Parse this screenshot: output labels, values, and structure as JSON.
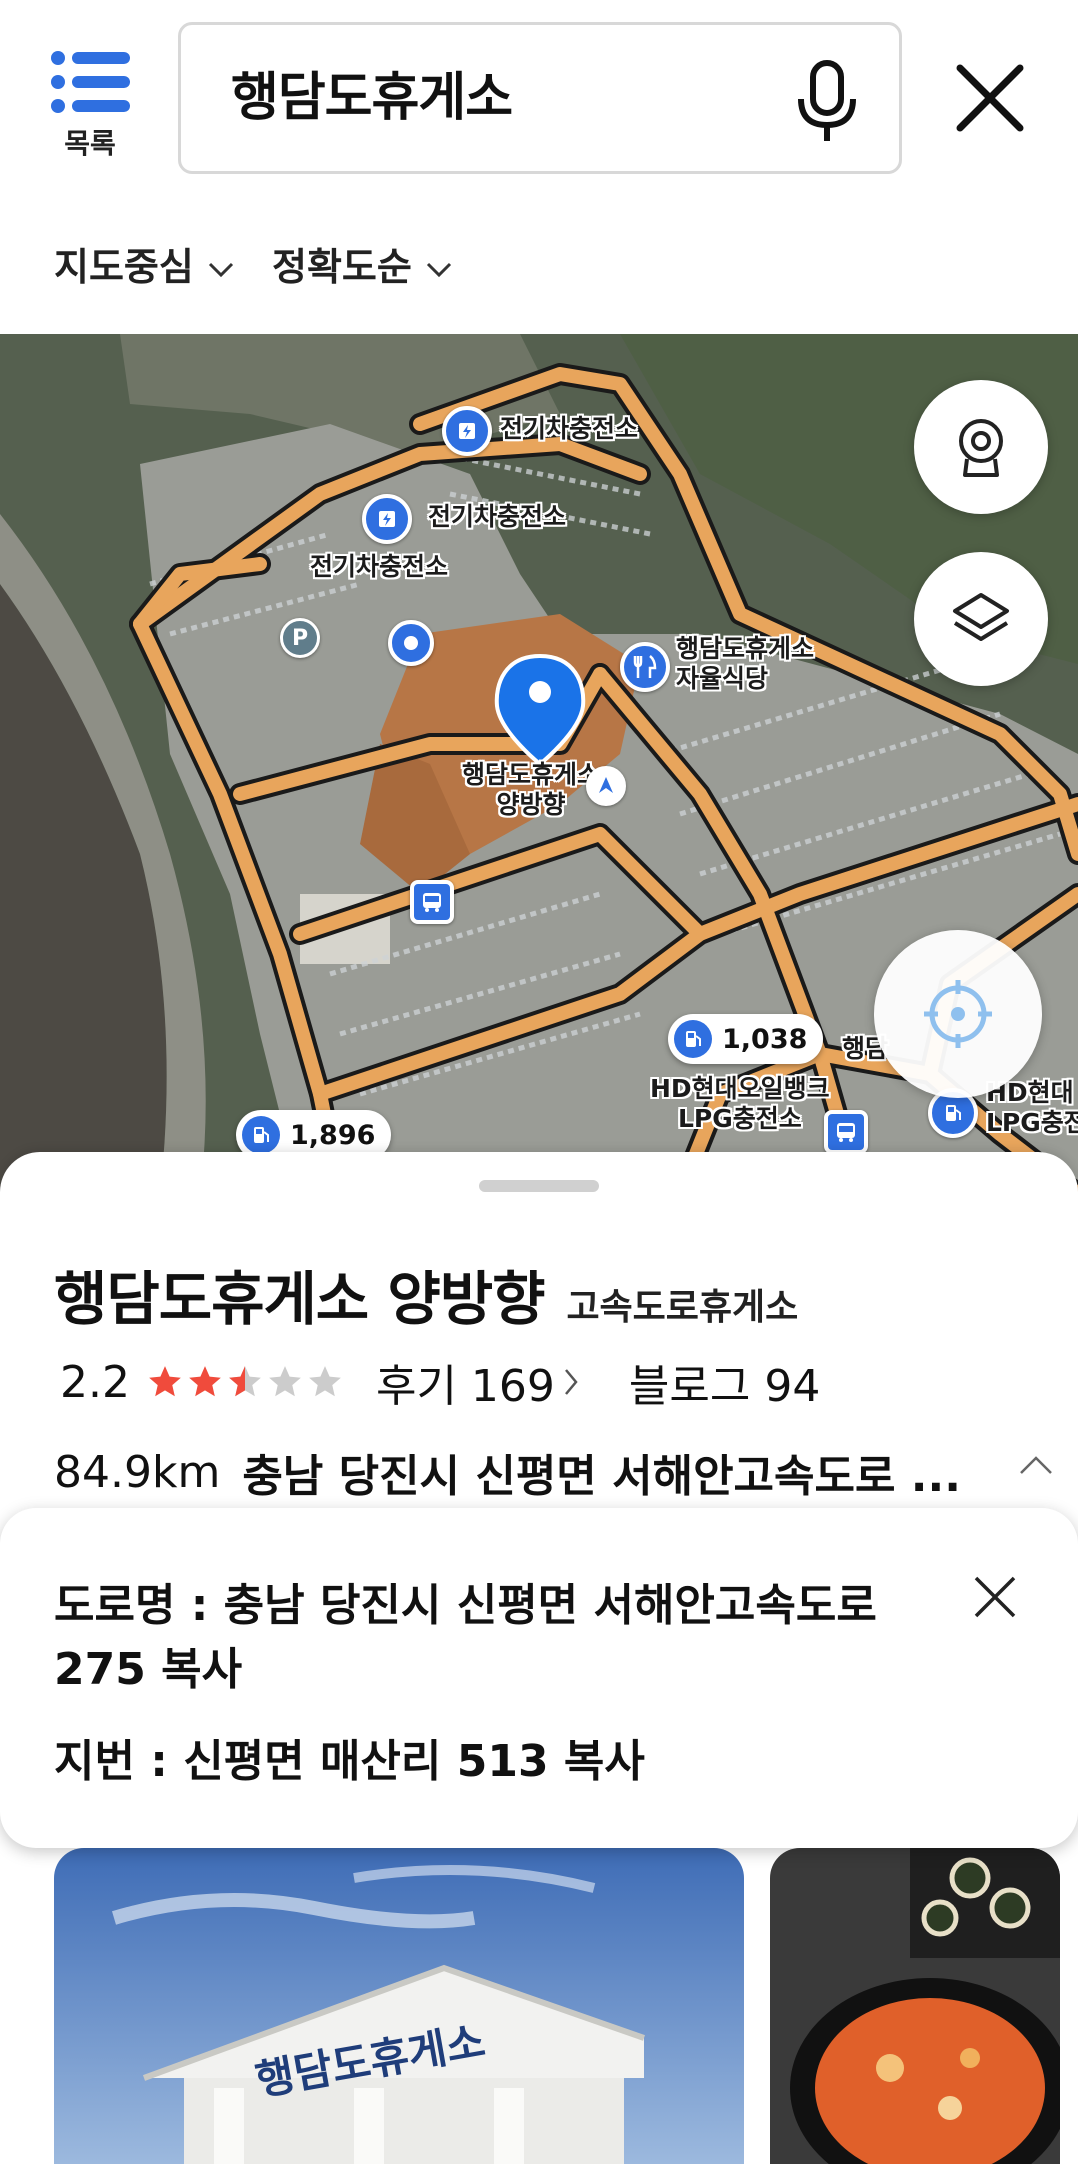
{
  "header": {
    "list_label": "목록",
    "search_value": "행담도휴게소",
    "icons": {
      "list": "list-icon",
      "mic": "mic-icon",
      "close": "close-icon"
    }
  },
  "filters": [
    {
      "label": "지도중심"
    },
    {
      "label": "정확도순"
    }
  ],
  "map": {
    "labels": {
      "ev1": "전기차충전소",
      "ev2": "전기차충전소",
      "ev3": "전기차충전소",
      "restaurant": "행담도휴게소\n자율식당",
      "main": "행담도휴게소\n양방향",
      "hd_station": "HD현대오일뱅크\nLPG충전소",
      "hd_station_right": "HD현대\nLPG충전",
      "haengdam_partial": "행담"
    },
    "prices": {
      "gas1": "1,038",
      "gas2": "1,896"
    },
    "colors": {
      "road": "#e8a55c",
      "poi_blue": "#2f6fe0",
      "pin_blue": "#1a73e8"
    }
  },
  "place": {
    "name": "행담도휴게소 양방향",
    "category": "고속도로휴게소",
    "rating": "2.2",
    "rating_value": 2.2,
    "reviews_label": "후기 169",
    "blog_label": "블로그 94",
    "distance": "84.9km",
    "address_short": "충남 당진시 신평면 서해안고속도로 ..."
  },
  "address_popup": {
    "road_line1": "도로명 : 충남 당진시 신평면 서해안고속도로",
    "road_line2": "275 복사",
    "jibun": "지번 : 신평면 매산리 513 복사"
  },
  "photos": {
    "sign_text": "행담도휴게소"
  }
}
